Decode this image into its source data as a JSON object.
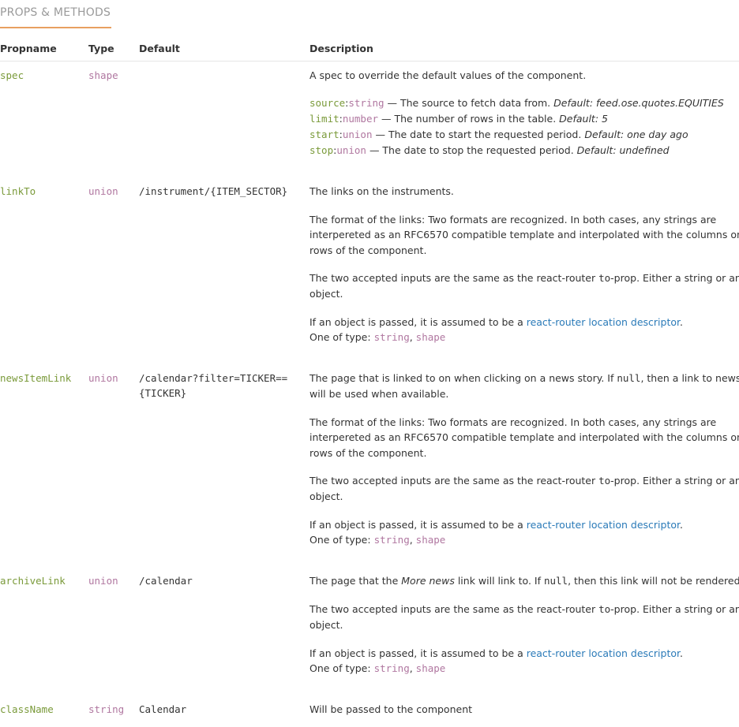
{
  "tab": {
    "label": "PROPS & METHODS"
  },
  "headers": {
    "propname": "Propname",
    "type": "Type",
    "default": "Default",
    "description": "Description"
  },
  "common": {
    "format_line1": "The format of the links: Two formats are recognized. In both cases, any strings are",
    "format_line2": "interpereted as an RFC6570 compatible template and interpolated with the columns on the",
    "format_line3": "rows of the component.",
    "inputs_line1_pre": "The two accepted inputs are the same as the react-router ",
    "inputs_line1_code": "to",
    "inputs_line1_post": "-prop. Either a string or an",
    "inputs_line2": "object.",
    "obj_pre": "If an object is passed, it is assumed to be a ",
    "obj_link": "react-router location descriptor",
    "obj_post": ".",
    "oneof_label": "One of type: ",
    "oneof_t1": "string",
    "oneof_sep": ", ",
    "oneof_t2": "shape"
  },
  "rows": {
    "spec": {
      "name": "spec",
      "type": "shape",
      "default": "",
      "desc": "A spec to override the default values of the component.",
      "fields": [
        {
          "key": "source",
          "type": "string",
          "text": " — The source to fetch data from. ",
          "def": "Default: feed.ose.quotes.EQUITIES"
        },
        {
          "key": "limit",
          "type": "number",
          "text": " — The number of rows in the table. ",
          "def": "Default: 5"
        },
        {
          "key": "start",
          "type": "union",
          "text": " — The date to start the requested period. ",
          "def": "Default: one day ago"
        },
        {
          "key": "stop",
          "type": "union",
          "text": " — The date to stop the requested period. ",
          "def": "Default: undefined"
        }
      ]
    },
    "linkTo": {
      "name": "linkTo",
      "type": "union",
      "default": "/instrument/{ITEM_SECTOR}",
      "desc": "The links on the instruments."
    },
    "newsItemLink": {
      "name": "newsItemLink",
      "type": "union",
      "default_line1": "/calendar?filter=TICKER==",
      "default_line2": "{TICKER}",
      "desc_pre": "The page that is linked to on when clicking on a news story. If ",
      "desc_code": "null",
      "desc_post": ", then a link to newsweb",
      "desc_line2": "will be used when available."
    },
    "archiveLink": {
      "name": "archiveLink",
      "type": "union",
      "default": "/calendar",
      "desc_pre": "The page that the ",
      "desc_em": "More news",
      "desc_mid": " link will link to. If ",
      "desc_code": "null",
      "desc_post": ", then this link will not be rendered."
    },
    "className": {
      "name": "className",
      "type": "string",
      "default": "Calendar",
      "desc": "Will be passed to the component"
    }
  },
  "colors": {
    "propname": "#7a9a3a",
    "type": "#b077a0",
    "link": "#2a7ab8",
    "tab_accent": "#e8a060"
  }
}
